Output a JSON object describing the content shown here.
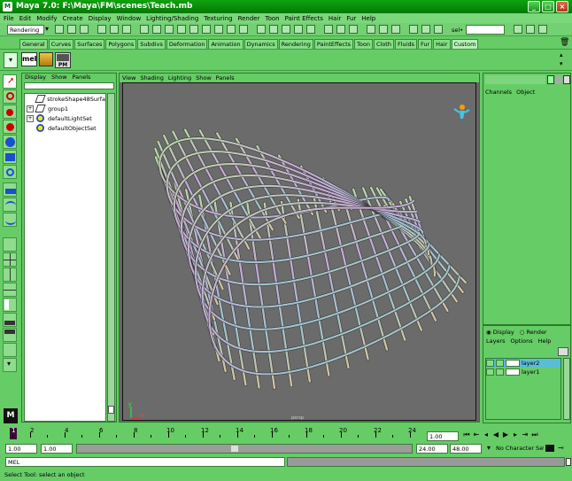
{
  "window": {
    "title": "Maya 7.0: F:\\Maya\\FM\\scenes\\Teach.mb",
    "minimize": "_",
    "maximize": "□",
    "close": "×"
  },
  "menu": [
    "File",
    "Edit",
    "Modify",
    "Create",
    "Display",
    "Window",
    "Lighting/Shading",
    "Texturing",
    "Render",
    "Toon",
    "Paint Effects",
    "Hair",
    "Fur",
    "Help"
  ],
  "status": {
    "mode": "Rendering",
    "sel_label": "sel•"
  },
  "shelf_tabs": [
    "General",
    "Curves",
    "Surfaces",
    "Polygons",
    "Subdivs",
    "Deformation",
    "Animation",
    "Dynamics",
    "Rendering",
    "PaintEffects",
    "Toon",
    "Cloth",
    "Fluids",
    "Fur",
    "Hair",
    "Custom"
  ],
  "shelf": {
    "active_tab": "Custom",
    "mel_label": "mel",
    "pm_label": "PM"
  },
  "outliner": {
    "menu": [
      "Display",
      "Show",
      "Panels"
    ],
    "items": [
      {
        "name": "strokeShape48Surfa",
        "expand": false,
        "icon": "stroke-icon"
      },
      {
        "name": "group1",
        "expand": true,
        "icon": "group-icon"
      },
      {
        "name": "defaultLightSet",
        "expand": true,
        "icon": "set-icon"
      },
      {
        "name": "defaultObjectSet",
        "expand": false,
        "icon": "set-icon"
      }
    ]
  },
  "viewport": {
    "menu": [
      "View",
      "Shading",
      "Lighting",
      "Show",
      "Panels"
    ],
    "camera_label": "persp",
    "axis": {
      "y": "y",
      "x": "x"
    }
  },
  "channel_box": {
    "tabs": [
      "Channels",
      "Object"
    ]
  },
  "layer_editor": {
    "display_label": "Display",
    "render_label": "Render",
    "menu": [
      "Layers",
      "Options",
      "Help"
    ],
    "layers": [
      "layer2",
      "layer1"
    ]
  },
  "time_slider": {
    "ticks": [
      "1",
      "2",
      "4",
      "6",
      "8",
      "10",
      "12",
      "14",
      "16",
      "18",
      "20",
      "22",
      "24"
    ],
    "current_frame": "1.00"
  },
  "range": {
    "start": "1.00",
    "playback_start": "1.00",
    "playback_end": "24.00",
    "end": "48.00",
    "character_set": "No Character Set"
  },
  "command": {
    "label": "MEL"
  },
  "help_line": "Select Tool: select an object",
  "colors": {
    "ui_green": "#66cc66",
    "title": "#0a8f0a",
    "viewport_bg": "#6b6b6b"
  }
}
